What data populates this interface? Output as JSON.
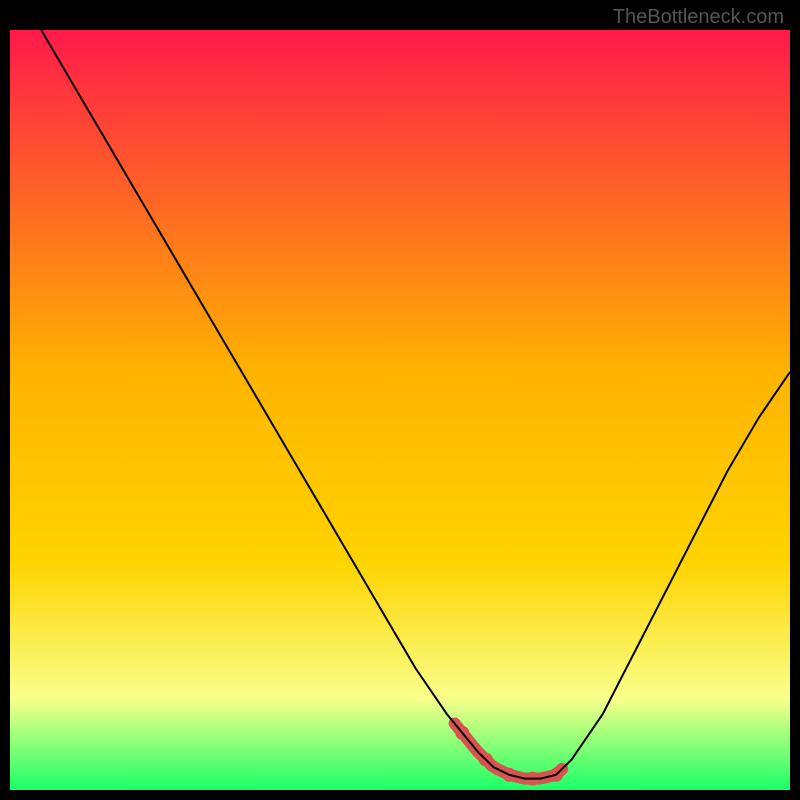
{
  "watermark": "TheBottleneck.com",
  "chart_data": {
    "type": "line",
    "title": "",
    "xlabel": "",
    "ylabel": "",
    "xlim": [
      0,
      100
    ],
    "ylim": [
      0,
      100
    ],
    "curve_points_x": [
      4,
      8,
      12,
      16,
      20,
      24,
      28,
      32,
      36,
      40,
      44,
      48,
      52,
      56,
      60,
      62,
      64,
      66,
      68,
      70,
      72,
      76,
      80,
      84,
      88,
      92,
      96,
      100
    ],
    "curve_points_y": [
      100,
      93,
      86,
      79,
      72,
      65,
      58,
      51,
      44,
      37,
      30,
      23,
      16,
      10,
      5,
      3,
      2,
      1.5,
      1.5,
      2,
      4,
      10,
      18,
      26,
      34,
      42,
      49,
      55
    ],
    "highlight_segment": {
      "x_start": 57,
      "x_end": 71,
      "color": "#d9534f",
      "note": "flat bottom region"
    },
    "background_gradient": {
      "top_color": "#ff1a4a",
      "mid_color": "#ffd400",
      "low_color": "#f8ff8a",
      "bottom_color": "#1aff66"
    },
    "curve_color": "#000000",
    "curve_width": 2
  }
}
